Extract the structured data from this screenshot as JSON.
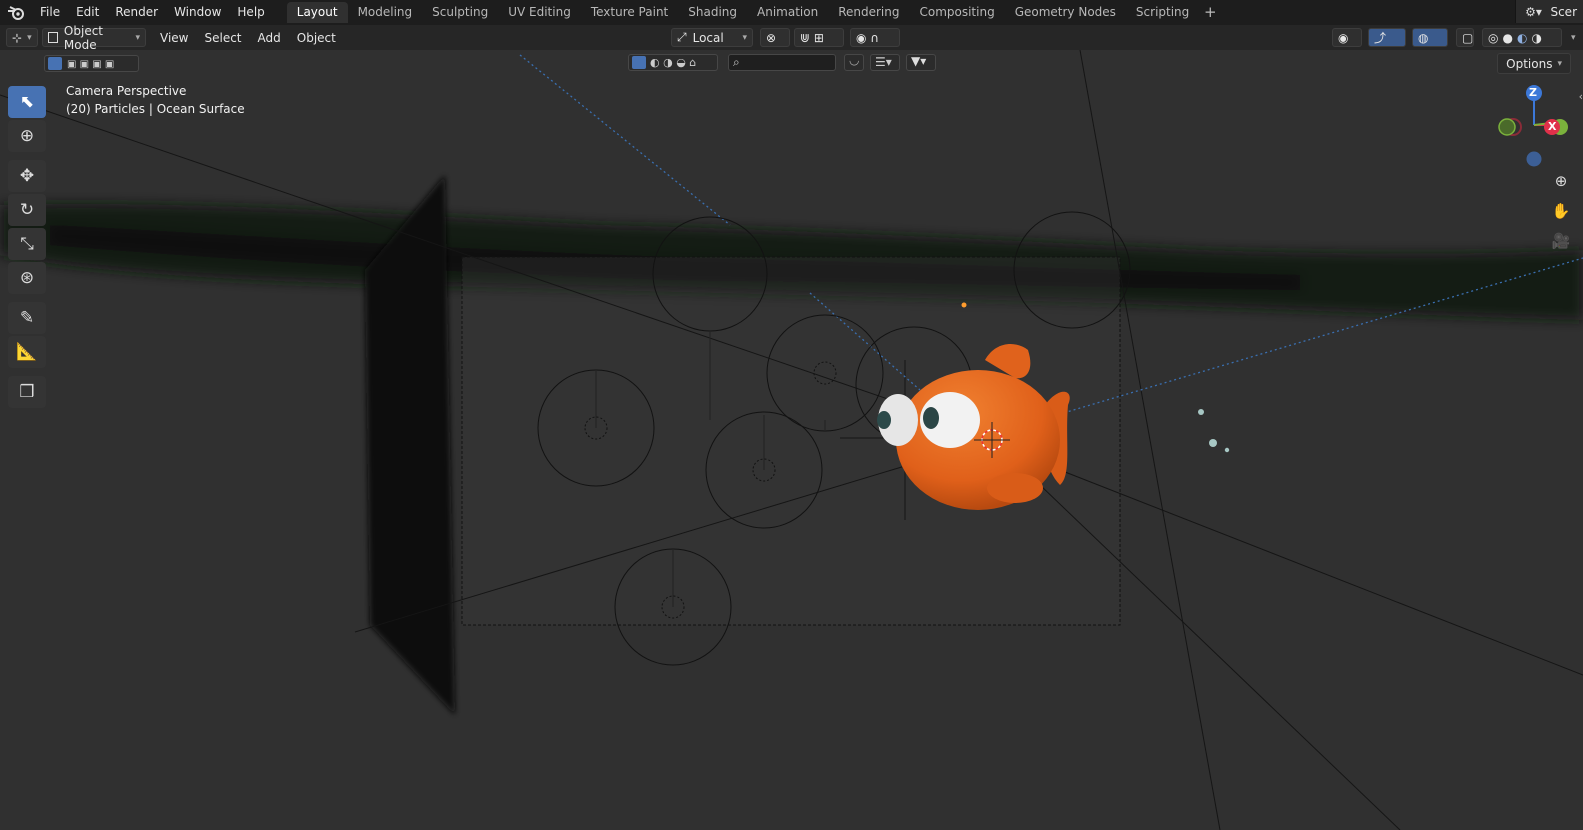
{
  "topbar": {
    "menus": [
      "File",
      "Edit",
      "Render",
      "Window",
      "Help"
    ],
    "tabs": [
      "Layout",
      "Modeling",
      "Sculpting",
      "UV Editing",
      "Texture Paint",
      "Shading",
      "Animation",
      "Rendering",
      "Compositing",
      "Geometry Nodes",
      "Scripting"
    ],
    "active_tab": "Layout",
    "add_tab": "+",
    "scene_label": "Scer"
  },
  "header": {
    "mode": "Object Mode",
    "menus": [
      "View",
      "Select",
      "Add",
      "Object"
    ],
    "orientation": "Local",
    "options_label": "Options"
  },
  "viewport": {
    "view_name": "Camera Perspective",
    "object_info": "(20) Particles | Ocean Surface"
  },
  "gizmo": {
    "z": "Z",
    "x": "X"
  },
  "colors": {
    "accent": "#4772b3",
    "fish": "#e8641e",
    "x_axis": "#e0314a",
    "y_axis": "#7bb23c",
    "z_axis": "#3c78d8"
  }
}
